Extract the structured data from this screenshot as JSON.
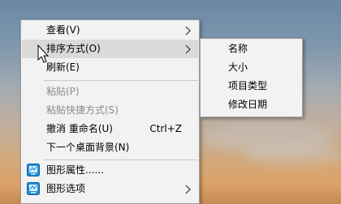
{
  "context_menu": {
    "items": [
      {
        "label": "查看(V)",
        "has_submenu": true
      },
      {
        "label": "排序方式(O)",
        "has_submenu": true,
        "highlighted": true
      },
      {
        "label": "刷新(E)"
      },
      {
        "label": "粘贴(P)",
        "disabled": true
      },
      {
        "label": "粘贴快捷方式(S)",
        "disabled": true
      },
      {
        "label": "撤消 重命名(U)",
        "shortcut": "Ctrl+Z"
      },
      {
        "label": "下一个桌面背景(N)"
      },
      {
        "label": "图形属性......",
        "icon": "intel-graphics-icon"
      },
      {
        "label": "图形选项",
        "icon": "intel-graphics-icon",
        "has_submenu": true
      }
    ]
  },
  "sort_submenu": {
    "items": [
      {
        "label": "名称"
      },
      {
        "label": "大小"
      },
      {
        "label": "项目类型"
      },
      {
        "label": "修改日期"
      }
    ]
  },
  "colors": {
    "menu_bg": "#f2f2f2",
    "highlight": "#dadada",
    "disabled_text": "#8a8a8a",
    "icon_blue": "#1e8fd8"
  }
}
